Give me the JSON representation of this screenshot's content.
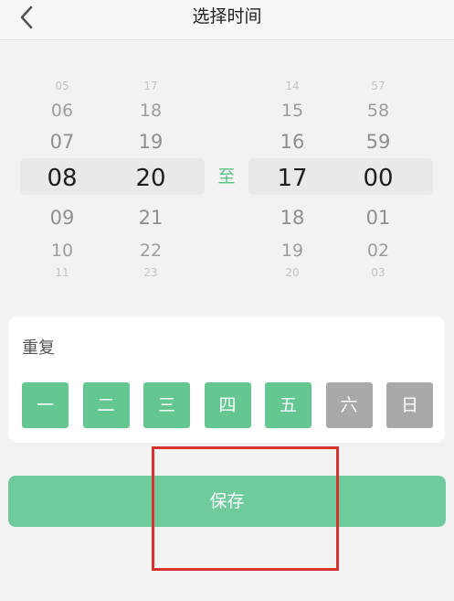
{
  "header": {
    "title": "选择时间"
  },
  "picker": {
    "separator": "至",
    "start_hour": [
      "05",
      "06",
      "07",
      "08",
      "09",
      "10",
      "11"
    ],
    "start_minute": [
      "17",
      "18",
      "19",
      "20",
      "21",
      "22",
      "23"
    ],
    "end_hour": [
      "14",
      "15",
      "16",
      "17",
      "18",
      "19",
      "20"
    ],
    "end_minute": [
      "57",
      "58",
      "59",
      "00",
      "01",
      "02",
      "03"
    ],
    "selected": {
      "start_hour": "08",
      "start_minute": "20",
      "end_hour": "17",
      "end_minute": "00"
    }
  },
  "repeat": {
    "label": "重复",
    "days": [
      {
        "label": "一",
        "active": true
      },
      {
        "label": "二",
        "active": true
      },
      {
        "label": "三",
        "active": true
      },
      {
        "label": "四",
        "active": true
      },
      {
        "label": "五",
        "active": true
      },
      {
        "label": "六",
        "active": false
      },
      {
        "label": "日",
        "active": false
      }
    ]
  },
  "save_label": "保存",
  "colors": {
    "accent": "#64c690",
    "inactive": "#a9a9a9",
    "highlight": "#d8322d"
  }
}
